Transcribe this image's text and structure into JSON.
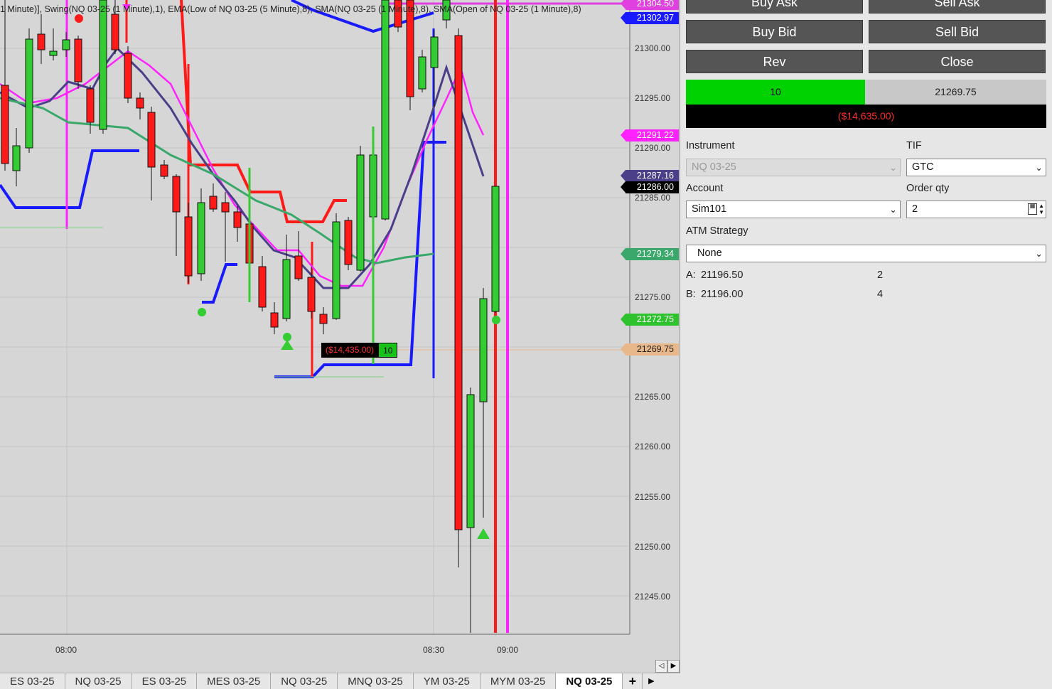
{
  "chart": {
    "indicator_text": "1 Minute)], Swing(NQ 03-25 (1 Minute),1), EMA(Low of NQ 03-25 (5 Minute),8), SMA(NQ 03-25 (1 Minute),8), SMA(Open of NQ 03-25 (1 Minute),8)",
    "price_axis": [
      "21300.00",
      "21295.00",
      "21290.00",
      "21285.00",
      "21275.00",
      "21265.00",
      "21260.00",
      "21255.00",
      "21250.00",
      "21245.00"
    ],
    "time_axis": [
      "08:00",
      "08:30",
      "09:00"
    ],
    "price_labels": [
      {
        "value": "21304.50",
        "bg": "#e040e0",
        "fg": "#ffffff"
      },
      {
        "value": "21302.97",
        "bg": "#1a1aff",
        "fg": "#ffffff"
      },
      {
        "value": "21291.22",
        "bg": "#ff22ff",
        "fg": "#ffffff"
      },
      {
        "value": "21287.16",
        "bg": "#4b3f8a",
        "fg": "#ffffff"
      },
      {
        "value": "21286.00",
        "bg": "#000000",
        "fg": "#ffffff"
      },
      {
        "value": "21279.34",
        "bg": "#3aa86a",
        "fg": "#ffffff"
      },
      {
        "value": "21272.75",
        "bg": "#2ec22e",
        "fg": "#ffffff"
      },
      {
        "value": "21269.75",
        "bg": "#e8b88a",
        "fg": "#222222"
      }
    ],
    "position_marker": {
      "pnl": "($14,435.00)",
      "qty": "10"
    },
    "scroll_left": "◁",
    "scroll_right": "▶"
  },
  "tabs": [
    "ES 03-25",
    "NQ 03-25",
    "ES 03-25",
    "MES 03-25",
    "NQ 03-25",
    "MNQ 03-25",
    "YM 03-25",
    "MYM 03-25",
    "NQ 03-25"
  ],
  "active_tab_index": 8,
  "tab_add_label": "+",
  "tab_menu_label": "▶",
  "order_entry": {
    "buy_ask": "Buy Ask",
    "sell_ask": "Sell Ask",
    "buy_bid": "Buy Bid",
    "sell_bid": "Sell Bid",
    "rev": "Rev",
    "close": "Close",
    "position_qty": "10",
    "avg_price": "21269.75",
    "unrealized_pnl": "($14,635.00)",
    "instrument_label": "Instrument",
    "instrument_value": "NQ 03-25",
    "tif_label": "TIF",
    "tif_value": "GTC",
    "account_label": "Account",
    "account_value": "Sim101",
    "order_qty_label": "Order qty",
    "order_qty_value": "2",
    "atm_label": "ATM Strategy",
    "atm_value": "None",
    "ask_label": "A:",
    "ask_price": "21196.50",
    "ask_size": "2",
    "bid_label": "B:",
    "bid_price": "21196.00",
    "bid_size": "4"
  },
  "colors": {
    "bull": "#33cc33",
    "bear": "#ff1a1a",
    "background": "#d6d6d6"
  }
}
